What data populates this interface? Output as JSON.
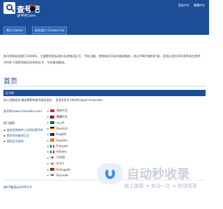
{
  "header": {
    "title": "查号吧",
    "domain": "查号吧.com",
    "links": [
      "登录中文",
      "繁體中文"
    ],
    "tabs": [
      "首页 (Home)",
      "联系我们 (Contact Us)"
    ]
  },
  "intro": "查号吧网站创建于2008年，主要提供国际国内长途电话区号、手机归属、地铁电话号码的查询服务。经过不断完善和扩展，目前已经向200多种语言提供200多个国家和地区的相关区号、号码查询服务。",
  "page_heading": "首页",
  "section": {
    "header": "区号吧",
    "prompt": "进入切换语言/请选择您的查号网站语言：  多语言区号 (Multilingual Areacode)",
    "current_site": "查号吧(www.chahaoba.com)",
    "hot_search_label": "热门搜索：",
    "hot_links": [
      "查询全国各种三位四位数号码",
      "常用号码查询汇总",
      "国际区号查询"
    ]
  },
  "languages": [
    {
      "label": "简体中文",
      "flag": "cn"
    },
    {
      "label": "繁體中文",
      "flag": "tw"
    },
    {
      "label": "العربية",
      "flag": "sa"
    },
    {
      "label": "Deutsch",
      "flag": "de"
    },
    {
      "label": "English",
      "flag": "gb"
    },
    {
      "label": "Español",
      "flag": "es"
    },
    {
      "label": "Français",
      "flag": "fr"
    },
    {
      "label": "Italiano",
      "flag": "it"
    },
    {
      "label": "日本語",
      "flag": "jp"
    },
    {
      "label": "한국어",
      "flag": "kr"
    },
    {
      "label": "Português",
      "flag": "pt"
    },
    {
      "label": "Pусский",
      "flag": "ru"
    }
  ],
  "footer": {
    "link": "查ICP备案@2009号-8"
  },
  "watermark": {
    "main": "自动秒收录",
    "sub": "做上链接 ➔ 来访一次 ➔ 自动收录"
  },
  "colors": {
    "brand": "#1b4e96",
    "link": "#1b4e96",
    "tab": "#2d66b8"
  }
}
